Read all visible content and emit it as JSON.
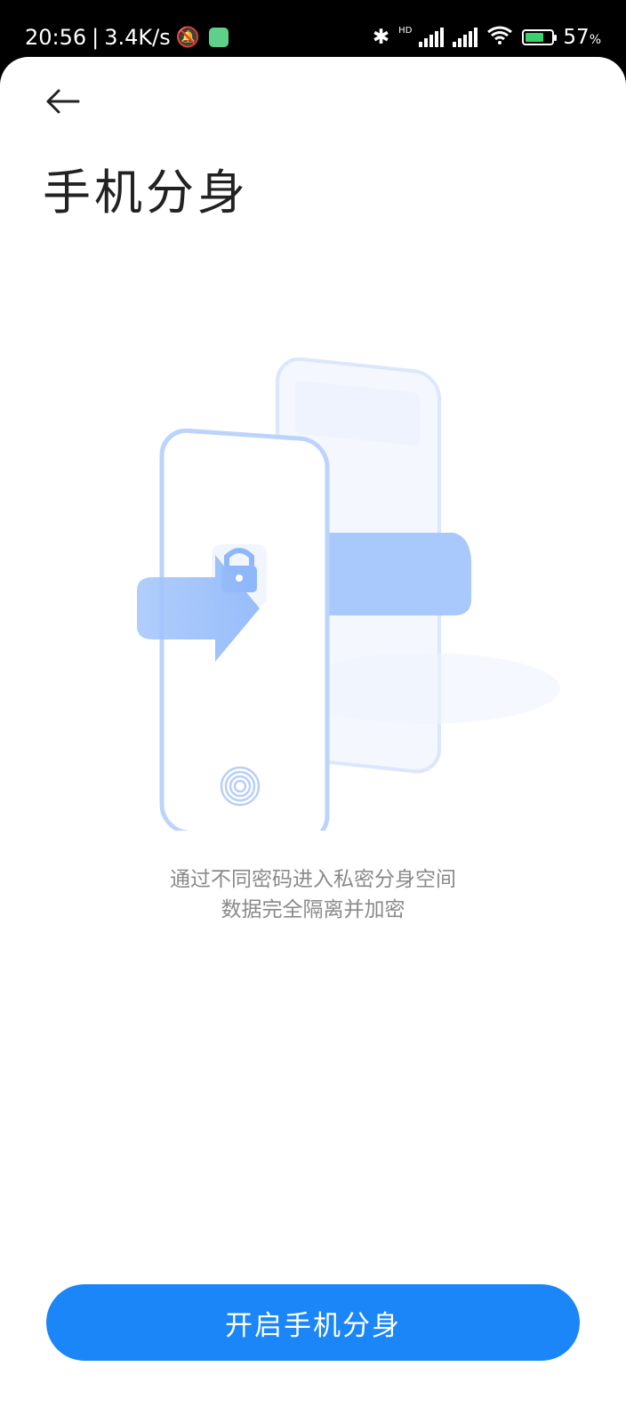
{
  "status_bar": {
    "time": "20:56",
    "network_speed": "3.4K/s",
    "battery_percent": "57",
    "battery_percent_sign": "%",
    "hd_label": "HD",
    "icons": [
      "muted-alarm-icon",
      "notification-app-icon",
      "bluetooth-icon",
      "signal-icon",
      "wifi-icon",
      "battery-icon"
    ]
  },
  "header": {
    "title": "手机分身"
  },
  "description": {
    "line1": "通过不同密码进入私密分身空间",
    "line2": "数据完全隔离并加密"
  },
  "cta": {
    "label": "开启手机分身"
  },
  "colors": {
    "accent": "#1a86f7",
    "illustration_blue": "#8fb8fb"
  }
}
